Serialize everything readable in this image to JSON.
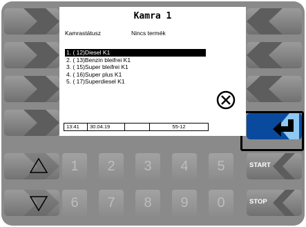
{
  "screen": {
    "title": "Kamra 1",
    "status_label": "Kamrastátusz",
    "status_value": "Nincs termék"
  },
  "product_list": [
    {
      "label": "1.  ( 12)Diesel K1",
      "selected": true
    },
    {
      "label": "2.  ( 13)Benzin bleifrei K1",
      "selected": false
    },
    {
      "label": "3.  ( 15)Super bleifrei K1",
      "selected": false
    },
    {
      "label": "4.  ( 16)Super plus K1",
      "selected": false
    },
    {
      "label": "5.  ( 17)Superdiesel K1",
      "selected": false
    }
  ],
  "status_bar": {
    "time": "13:41",
    "date": "30.04.19",
    "empty": "",
    "code": "55-12"
  },
  "keypad": {
    "row1": [
      "1",
      "2",
      "3",
      "4",
      "5"
    ],
    "row2": [
      "6",
      "7",
      "8",
      "9",
      "0"
    ],
    "start_label": "START",
    "stop_label": "STOP"
  },
  "icons": {
    "cancel": "cancel-x-icon",
    "enter": "enter-arrow-icon",
    "up": "triangle-up-icon",
    "down": "triangle-down-icon"
  },
  "colors": {
    "active_key": "#0a4a9e",
    "active_chevron": "#8fc8f0",
    "device_body": "#8a8a8a"
  }
}
